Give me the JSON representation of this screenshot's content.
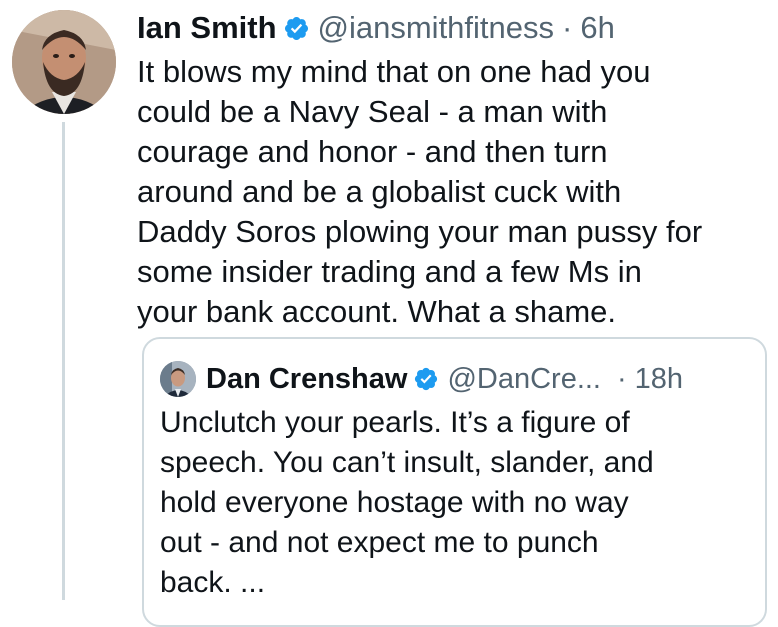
{
  "tweet": {
    "author_name": "Ian Smith",
    "handle": "@iansmithfitness",
    "separator": "·",
    "time": "6h",
    "verified_icon": "verified-badge-icon",
    "text_lines": [
      "It blows my mind that on one had you",
      "could be a Navy Seal - a man with",
      "courage and honor - and then turn",
      "around and be a globalist cuck with",
      "Daddy Soros plowing your man pussy for",
      "some insider trading and a few Ms in",
      "your bank account. What a shame."
    ]
  },
  "quoted_tweet": {
    "author_name": "Dan Crenshaw",
    "handle": "@DanCre...",
    "separator": "·",
    "time": "18h",
    "verified_icon": "verified-badge-icon",
    "text_lines": [
      "Unclutch your pearls. It’s a figure of",
      "speech. You can’t insult, slander, and",
      "hold everyone hostage with no way",
      "out - and not expect me to punch",
      "back. ..."
    ]
  },
  "colors": {
    "text_primary": "#0f1419",
    "text_secondary": "#536471",
    "verified_blue": "#1d9bf0",
    "border": "#cfd9de"
  }
}
